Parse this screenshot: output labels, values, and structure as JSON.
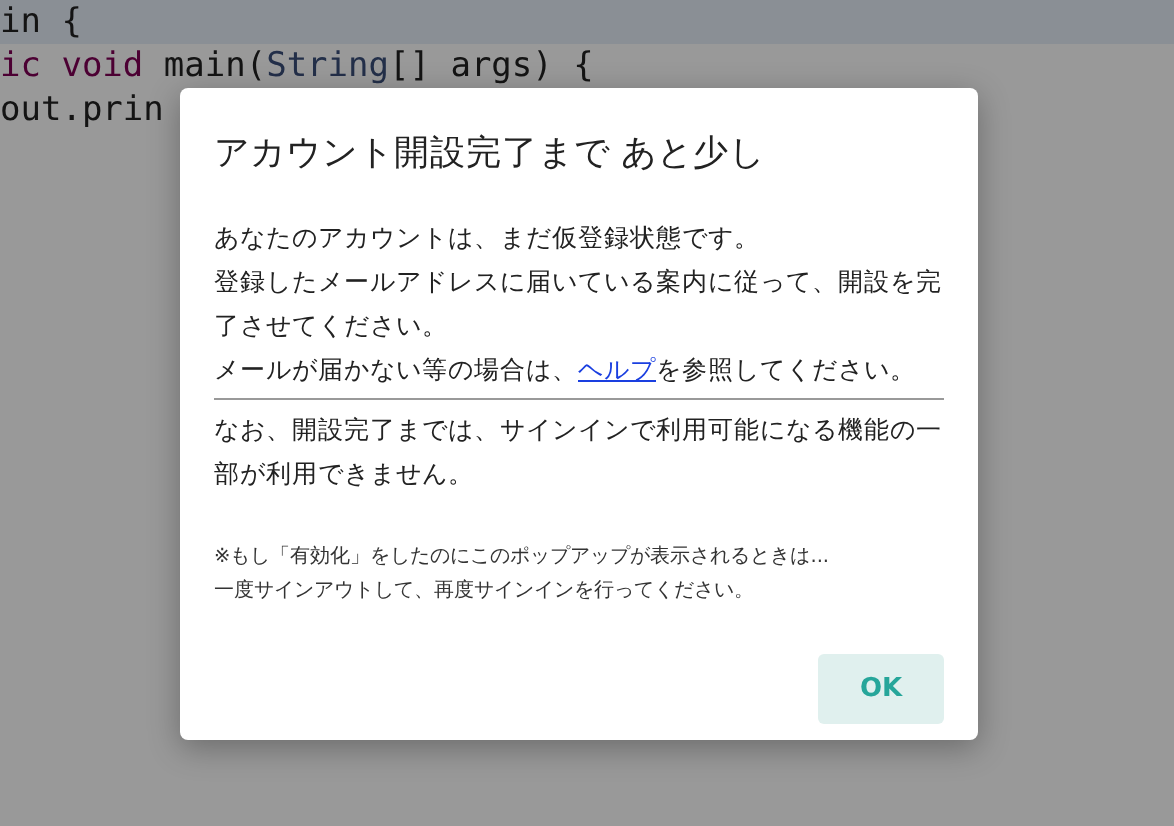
{
  "editor": {
    "lines": [
      {
        "current": true,
        "tokens": [
          {
            "kind": "plain",
            "text": "in {"
          }
        ]
      },
      {
        "current": false,
        "tokens": [
          {
            "kind": "keyword",
            "text": "ic void"
          },
          {
            "kind": "plain",
            "text": " main("
          },
          {
            "kind": "type",
            "text": "String"
          },
          {
            "kind": "plain",
            "text": "[] args) {"
          }
        ]
      },
      {
        "current": false,
        "tokens": [
          {
            "kind": "plain",
            "text": "out.prin"
          }
        ]
      }
    ]
  },
  "dialog": {
    "title": "アカウント開設完了まで あと少し",
    "paragraphs": [
      {
        "lines": [
          "あなたのアカウントは、まだ仮登録状態です。",
          "登録したメールアドレスに届いている案内に従って、開設を完了させてください。"
        ]
      },
      {
        "before": "メールが届かない等の場合は、",
        "link": "ヘルプ",
        "after": "を参照してください。"
      }
    ],
    "notice": "なお、開設完了までは、サインインで利用可能になる機能の一部が利用できません。",
    "footnote": [
      "※もし「有効化」をしたのにこのポップアップが表示されるときは...",
      "一度サインアウトして、再度サインインを行ってください。"
    ],
    "buttons": [
      "OK"
    ]
  }
}
